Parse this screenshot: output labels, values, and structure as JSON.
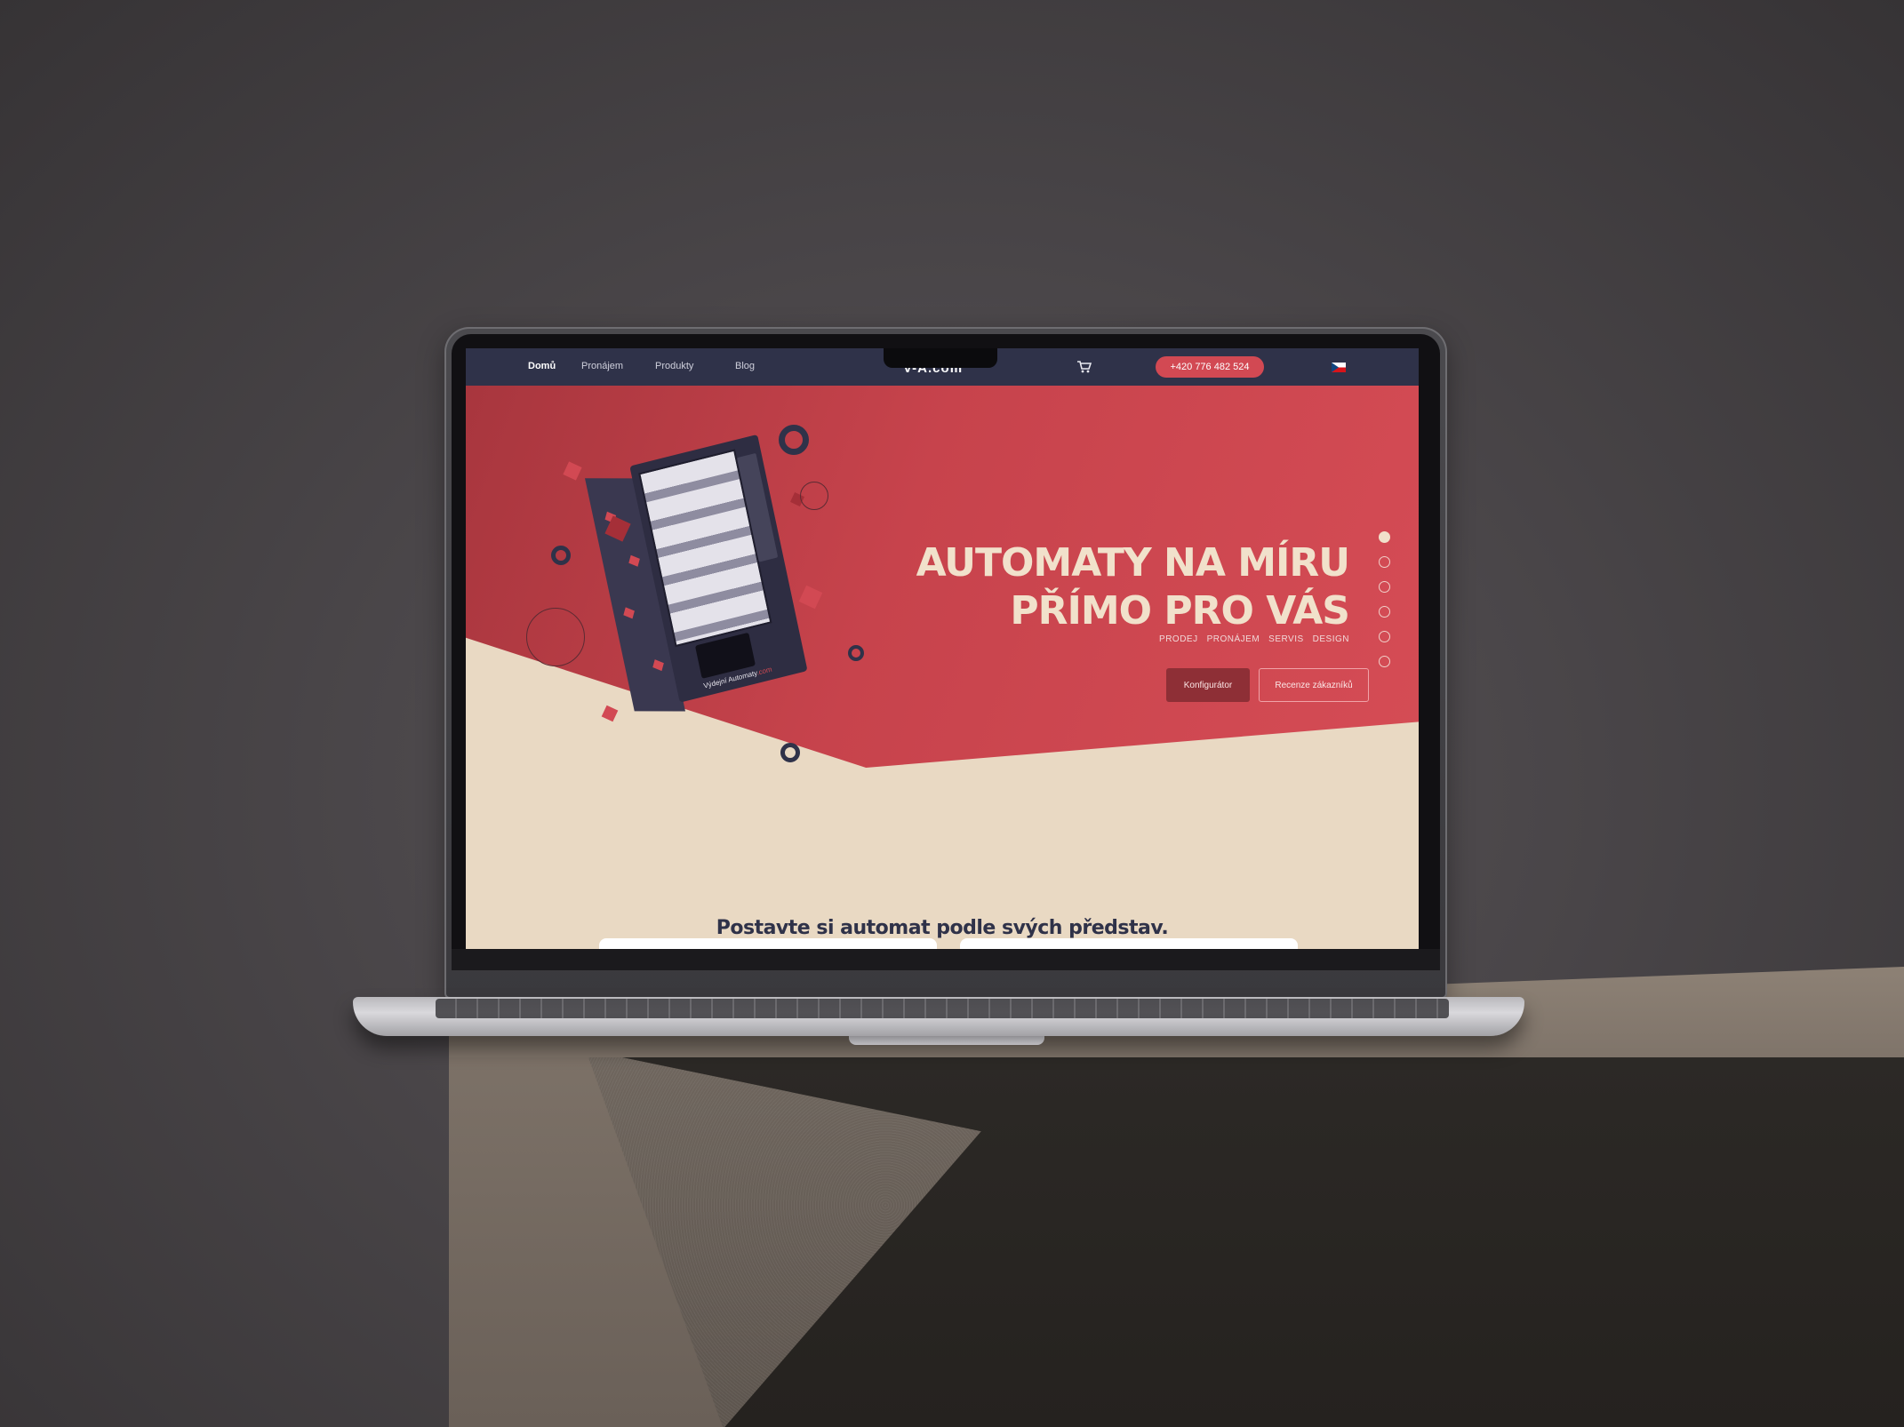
{
  "nav": {
    "items": [
      {
        "label": "Domů",
        "active": true
      },
      {
        "label": "Pronájem",
        "active": false
      },
      {
        "label": "Produkty",
        "active": false
      },
      {
        "label": "Blog",
        "active": false
      }
    ],
    "logo_main": "V-A",
    "logo_suffix": ".com",
    "phone": "+420 776 482 524",
    "cart_icon": "cart-icon",
    "language_flag": "czech-flag-icon"
  },
  "hero": {
    "headline_line1": "AUTOMATY NA MÍRU",
    "headline_line2": "PŘÍMO PRO VÁS",
    "tags": [
      "PRODEJ",
      "PRONÁJEM",
      "SERVIS",
      "DESIGN"
    ],
    "primary_button": "Konfigurátor",
    "secondary_button": "Recenze zákazníků",
    "slider_dots": 6,
    "active_dot": 1,
    "machine_brand": "Výdejní Automaty",
    "machine_brand_suffix": ".com"
  },
  "section": {
    "heading": "Postavte si automat podle svých představ."
  },
  "colors": {
    "nav_bg": "#2f3249",
    "accent_red": "#d24953",
    "cream": "#e9d9c3"
  }
}
